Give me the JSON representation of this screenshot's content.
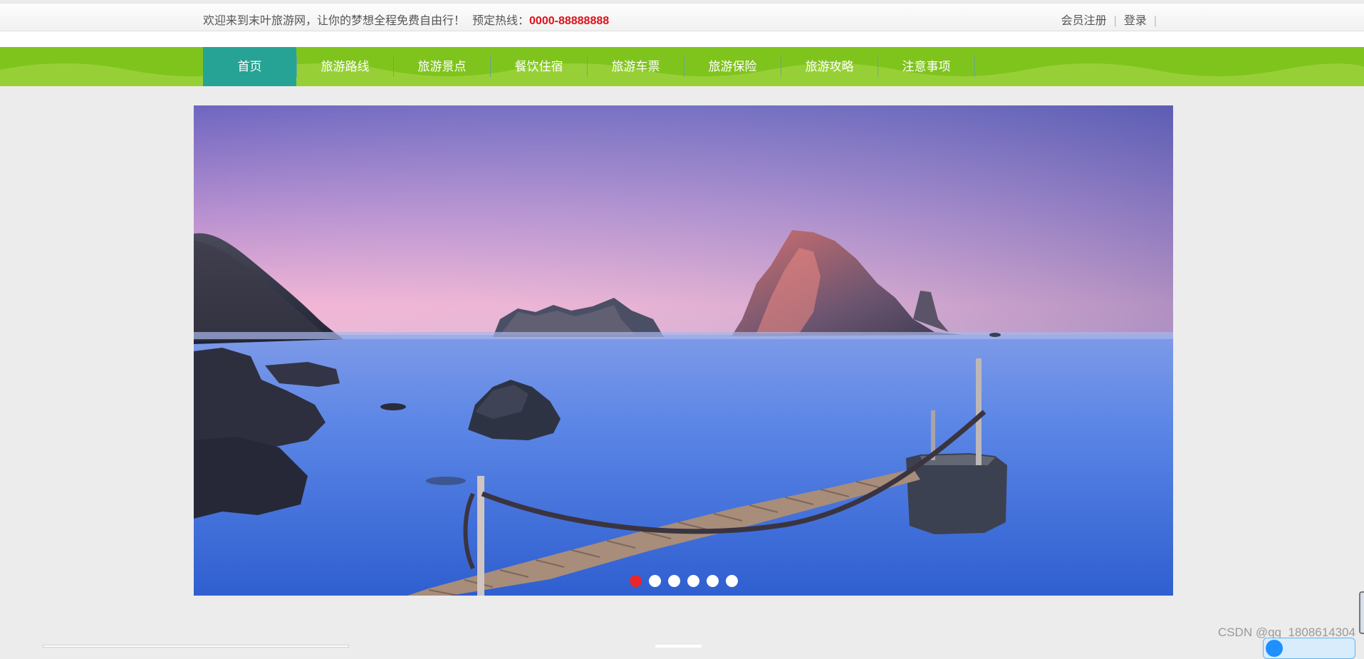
{
  "topbar": {
    "welcome": "欢迎来到末叶旅游网，让你的梦想全程免费自由行！",
    "hotline_label": "预定热线：",
    "hotline_number": "0000-88888888",
    "register": "会员注册",
    "separator": "|",
    "login": "登录",
    "trailing_separator": "|"
  },
  "nav": {
    "items": [
      {
        "label": "首页",
        "active": true
      },
      {
        "label": "旅游路线"
      },
      {
        "label": "旅游景点"
      },
      {
        "label": "餐饮住宿"
      },
      {
        "label": "旅游车票"
      },
      {
        "label": "旅游保险"
      },
      {
        "label": "旅游攻略"
      },
      {
        "label": "注意事项"
      }
    ]
  },
  "banner": {
    "slide_count": 6,
    "active_slide": 1
  },
  "colors": {
    "nav_green": "#7fc41c",
    "nav_active_teal": "#26a394",
    "hotline_red": "#e0101a",
    "active_dot": "#e8262b"
  },
  "watermark": "CSDN @qq_1808614304"
}
